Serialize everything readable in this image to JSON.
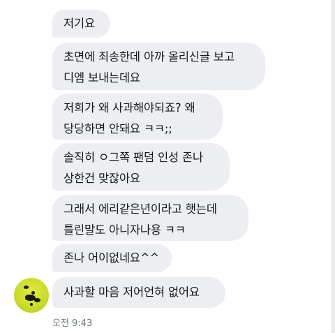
{
  "messages": [
    {
      "lines": [
        "저기요"
      ]
    },
    {
      "lines": [
        "초면에 죄송한데 아까 올리신글 보고",
        "디엠 보내는데요"
      ]
    },
    {
      "lines": [
        "저희가 왜 사과해야되죠? 왜",
        "당당하면 안돼요 ㅋㅋ;;"
      ]
    },
    {
      "lines": [
        "솔직히 ㅇ그쪽 팬덤 인성 존나",
        "상한건 맞잖아요"
      ]
    },
    {
      "lines": [
        "그래서 에리같은년이라고 햇는데",
        "틀린말도 아니자나용 ㅋㅋ"
      ]
    },
    {
      "lines": [
        "존나 어이없네요^^"
      ]
    },
    {
      "lines": [
        "사과할 마음 저어언혀 없어요"
      ]
    }
  ],
  "timestamp": "오전 9:43",
  "avatar": {
    "icon": "user-avatar",
    "color": "#cbdc2a"
  },
  "colors": {
    "bubble": "#eceef2",
    "text": "#15181c",
    "timestamp": "#6e767d"
  }
}
